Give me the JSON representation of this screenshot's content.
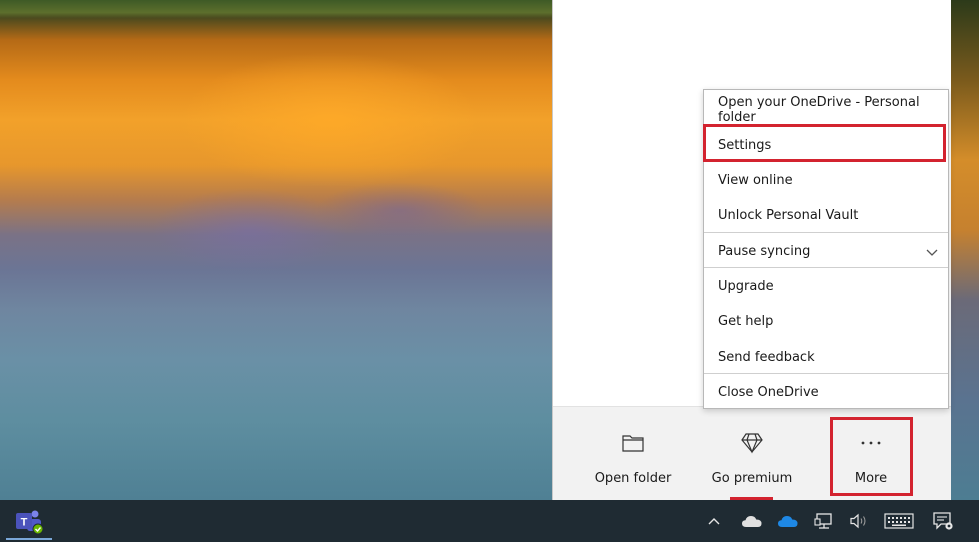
{
  "menu": {
    "items": [
      {
        "label": "Open your OneDrive - Personal folder"
      },
      {
        "label": "Settings"
      },
      {
        "label": "View online"
      },
      {
        "label": "Unlock Personal Vault"
      },
      {
        "label": "Pause syncing"
      },
      {
        "label": "Upgrade"
      },
      {
        "label": "Get help"
      },
      {
        "label": "Send feedback"
      },
      {
        "label": "Close OneDrive"
      }
    ]
  },
  "footer": {
    "open_folder": "Open folder",
    "go_premium": "Go premium",
    "more": "More"
  },
  "icons": {
    "folder": "folder-icon",
    "diamond": "diamond-icon",
    "more": "ellipsis-icon",
    "chevron": "chevron-down-icon",
    "teams": "teams-icon",
    "tray_overflow": "chevron-up-icon",
    "onedrive_personal": "onedrive-cloud-icon",
    "onedrive_work": "onedrive-blue-cloud-icon",
    "network": "network-icon",
    "volume": "volume-icon",
    "keyboard": "touch-keyboard-icon",
    "notifications": "action-center-icon"
  },
  "colors": {
    "highlight": "#d3232f",
    "taskbar": "#1f2b33",
    "onedrive_blue": "#1e88e5"
  }
}
